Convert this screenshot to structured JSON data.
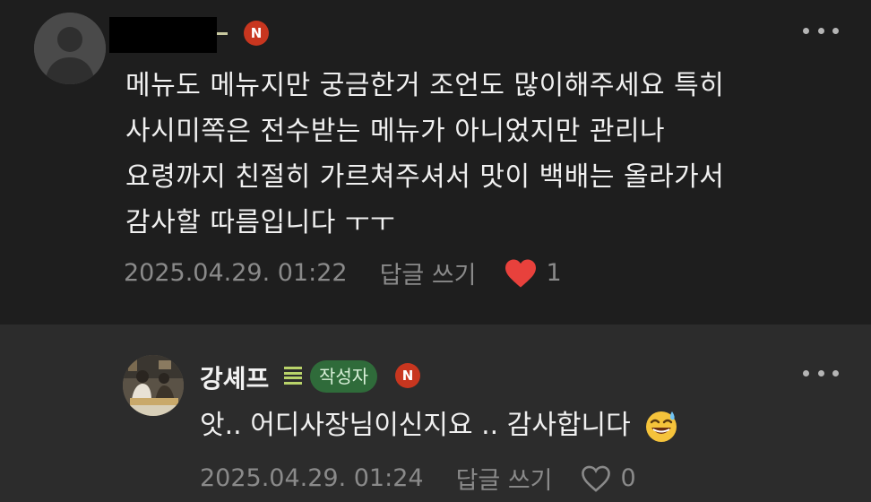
{
  "comment": {
    "author_badge": "N",
    "lines": [
      "메뉴도 메뉴지만 궁금한거 조언도 많이해주세요 특히",
      "사시미쪽은 전수받는 메뉴가 아니었지만 관리나",
      "요령까지 친절히 가르쳐주셔서 맛이 백배는 올라가서",
      "감사할 따름입니다 ㅜㅜ"
    ],
    "timestamp": "2025.04.29. 01:22",
    "reply_label": "답글 쓰기",
    "like_count": "1",
    "liked": true,
    "heart_color": "#e8413c"
  },
  "reply": {
    "author_name": "강셰프",
    "author_tag": "작성자",
    "author_badge": "N",
    "text": "앗.. 어디사장님이신지요 .. 감사합니다",
    "emoji": "grinning-face-with-sweat-emoji",
    "timestamp": "2025.04.29. 01:24",
    "reply_label": "답글 쓰기",
    "like_count": "0",
    "liked": false
  }
}
